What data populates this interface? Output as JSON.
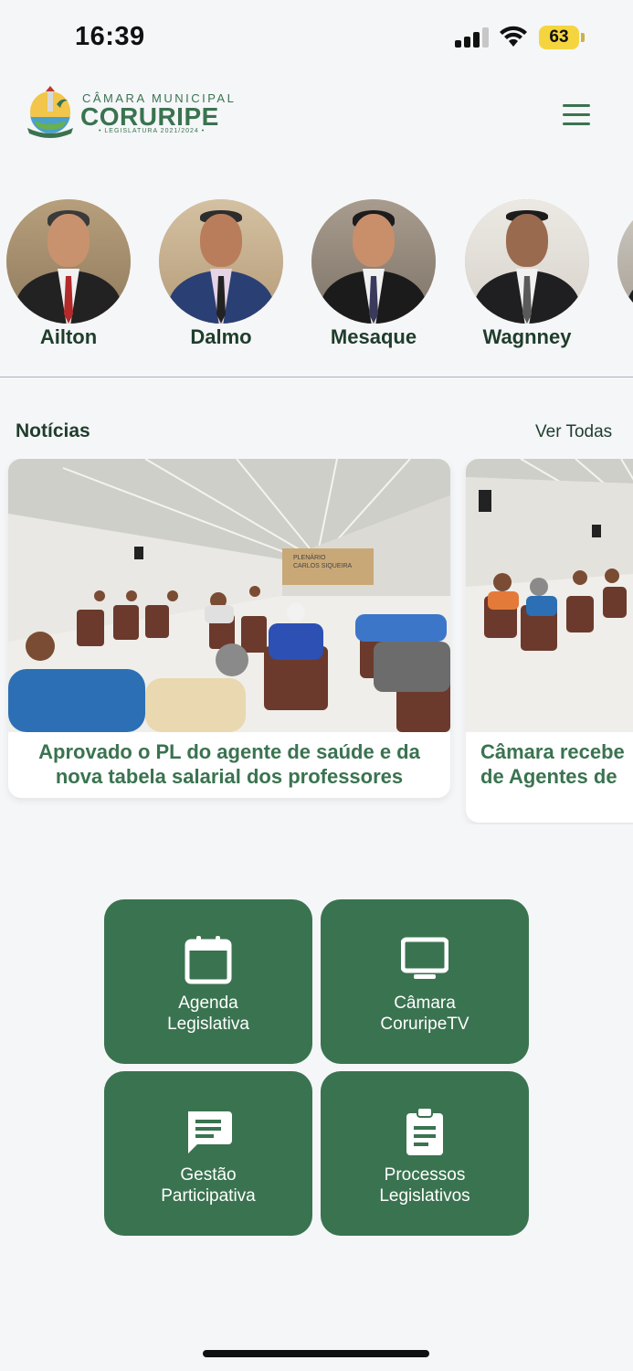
{
  "status_bar": {
    "time": "16:39",
    "battery": "63"
  },
  "header": {
    "logo_small": "CÂMARA MUNICIPAL",
    "logo_big": "CORURIPE",
    "logo_sub": "• LEGISLATURA 2021/2024 •",
    "menu_icon": "hamburger-menu-icon"
  },
  "councillors": [
    {
      "name": "Ailton"
    },
    {
      "name": "Dalmo"
    },
    {
      "name": "Mesaque"
    },
    {
      "name": "Wagnney"
    }
  ],
  "news": {
    "section_title": "Notícias",
    "see_all": "Ver Todas",
    "items": [
      {
        "caption": "Aprovado o PL do agente de saúde e da nova tabela salarial dos professores",
        "plenary_sign": "PLENÁRIO\nCARLOS SIQUEIRA"
      },
      {
        "caption": "Câmara recebe\nde Agentes de"
      }
    ]
  },
  "shortcuts": [
    {
      "label_1": "Agenda",
      "label_2": "Legislativa",
      "icon": "calendar-icon"
    },
    {
      "label_1": "Câmara",
      "label_2": "CoruripeTV",
      "icon": "monitor-icon"
    },
    {
      "label_1": "Gestão",
      "label_2": "Participativa",
      "icon": "chat-icon"
    },
    {
      "label_1": "Processos",
      "label_2": "Legislativos",
      "icon": "clipboard-icon"
    }
  ],
  "colors": {
    "brand_green": "#3a7350",
    "text_dark": "#1f3d2c",
    "background": "#f5f6f8"
  }
}
